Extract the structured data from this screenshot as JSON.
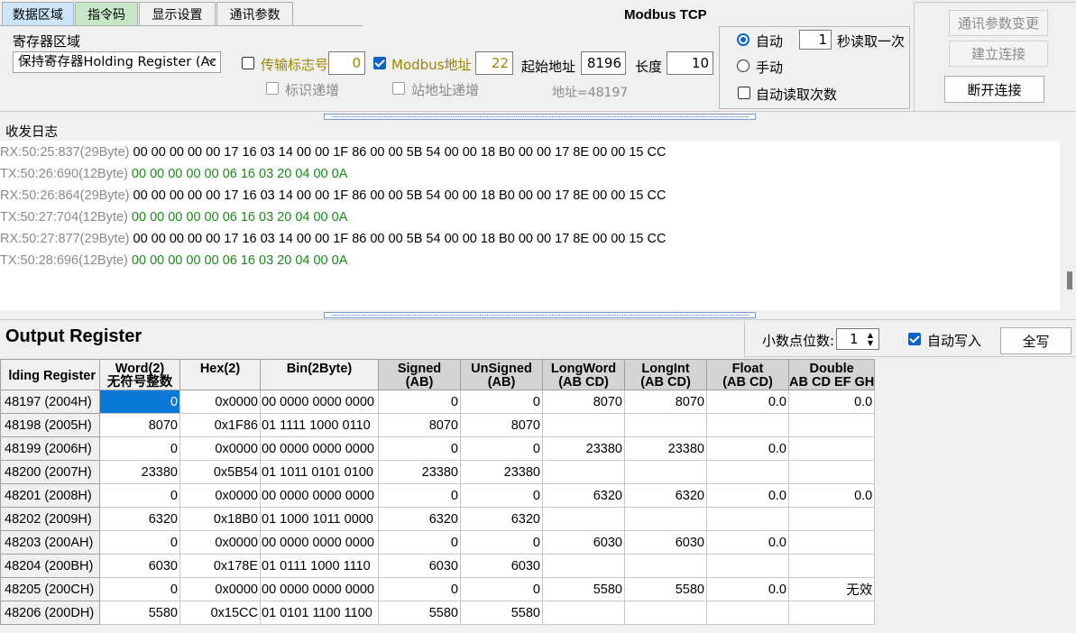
{
  "tabs": [
    "数据区域",
    "指令码",
    "显示设置",
    "通讯参数"
  ],
  "title": "Modbus TCP",
  "register_area": {
    "label": "寄存器区域",
    "selected": "保持寄存器Holding Register (Ac"
  },
  "transfer_id": {
    "label": "传输标志号",
    "value": "0",
    "checked": false
  },
  "modbus_addr": {
    "label": "Modbus地址",
    "value": "22",
    "checked": true
  },
  "start_addr": {
    "label": "起始地址",
    "value": "8196"
  },
  "length": {
    "label": "长度",
    "value": "10"
  },
  "id_increment": "标识递增",
  "station_increment": "站地址递增",
  "address_info": "地址=48197",
  "mode": {
    "auto_label": "自动",
    "interval": "1",
    "interval_suffix": "秒读取一次",
    "manual_label": "手动",
    "auto_read_count": "自动读取次数"
  },
  "buttons": {
    "change_params": "通讯参数变更",
    "connect": "建立连接",
    "disconnect": "断开连接",
    "write_all": "全写"
  },
  "log": {
    "title": "收发日志",
    "lines": [
      {
        "ts": "RX:50:25:837(29Byte)",
        "data": "00 00 00 00 00 17 16 03 14 00 00 1F 86 00 00 5B 54 00 00 18 B0 00 00 17 8E 00 00 15 CC",
        "dir": "rx"
      },
      {
        "ts": "TX:50:26:690(12Byte)",
        "data": "00 00 00 00 00 06 16 03 20 04 00 0A",
        "dir": "tx"
      },
      {
        "ts": "RX:50:26:864(29Byte)",
        "data": "00 00 00 00 00 17 16 03 14 00 00 1F 86 00 00 5B 54 00 00 18 B0 00 00 17 8E 00 00 15 CC",
        "dir": "rx"
      },
      {
        "ts": "TX:50:27:704(12Byte)",
        "data": "00 00 00 00 00 06 16 03 20 04 00 0A",
        "dir": "tx"
      },
      {
        "ts": "RX:50:27:877(29Byte)",
        "data": "00 00 00 00 00 17 16 03 14 00 00 1F 86 00 00 5B 54 00 00 18 B0 00 00 17 8E 00 00 15 CC",
        "dir": "rx"
      },
      {
        "ts": "TX:50:28:696(12Byte)",
        "data": "00 00 00 00 00 06 16 03 20 04 00 0A",
        "dir": "tx"
      }
    ]
  },
  "output": {
    "title": "Output Register",
    "decimal_label": "小数点位数:",
    "decimal_value": "1",
    "auto_write": "自动写入"
  },
  "table": {
    "headers": [
      [
        "lding Register",
        ""
      ],
      [
        "Word(2)",
        "无符号整数"
      ],
      [
        "Hex(2)",
        ""
      ],
      [
        "Bin(2Byte)",
        ""
      ],
      [
        "Signed",
        "(AB)"
      ],
      [
        "UnSigned",
        "(AB)"
      ],
      [
        "LongWord",
        "(AB CD)"
      ],
      [
        "LongInt",
        "(AB CD)"
      ],
      [
        "Float",
        "(AB CD)"
      ],
      [
        "Double",
        "AB CD EF GH"
      ]
    ],
    "rows": [
      [
        "48197 (2004H)",
        "0",
        "0x0000",
        "00 0000 0000 0000",
        "0",
        "0",
        "8070",
        "8070",
        "0.0",
        "0.0"
      ],
      [
        "48198 (2005H)",
        "8070",
        "0x1F86",
        "01 1111 1000 0110",
        "8070",
        "8070",
        "",
        "",
        "",
        ""
      ],
      [
        "48199 (2006H)",
        "0",
        "0x0000",
        "00 0000 0000 0000",
        "0",
        "0",
        "23380",
        "23380",
        "0.0",
        ""
      ],
      [
        "48200 (2007H)",
        "23380",
        "0x5B54",
        "01 1011 0101 0100",
        "23380",
        "23380",
        "",
        "",
        "",
        ""
      ],
      [
        "48201 (2008H)",
        "0",
        "0x0000",
        "00 0000 0000 0000",
        "0",
        "0",
        "6320",
        "6320",
        "0.0",
        "0.0"
      ],
      [
        "48202 (2009H)",
        "6320",
        "0x18B0",
        "01 1000 1011 0000",
        "6320",
        "6320",
        "",
        "",
        "",
        ""
      ],
      [
        "48203 (200AH)",
        "0",
        "0x0000",
        "00 0000 0000 0000",
        "0",
        "0",
        "6030",
        "6030",
        "0.0",
        ""
      ],
      [
        "48204 (200BH)",
        "6030",
        "0x178E",
        "01 0111 1000 1110",
        "6030",
        "6030",
        "",
        "",
        "",
        ""
      ],
      [
        "48205 (200CH)",
        "0",
        "0x0000",
        "00 0000 0000 0000",
        "0",
        "0",
        "5580",
        "5580",
        "0.0",
        "无效"
      ],
      [
        "48206 (200DH)",
        "5580",
        "0x15CC",
        "01 0101 1100 1100",
        "5580",
        "5580",
        "",
        "",
        "",
        ""
      ]
    ]
  }
}
